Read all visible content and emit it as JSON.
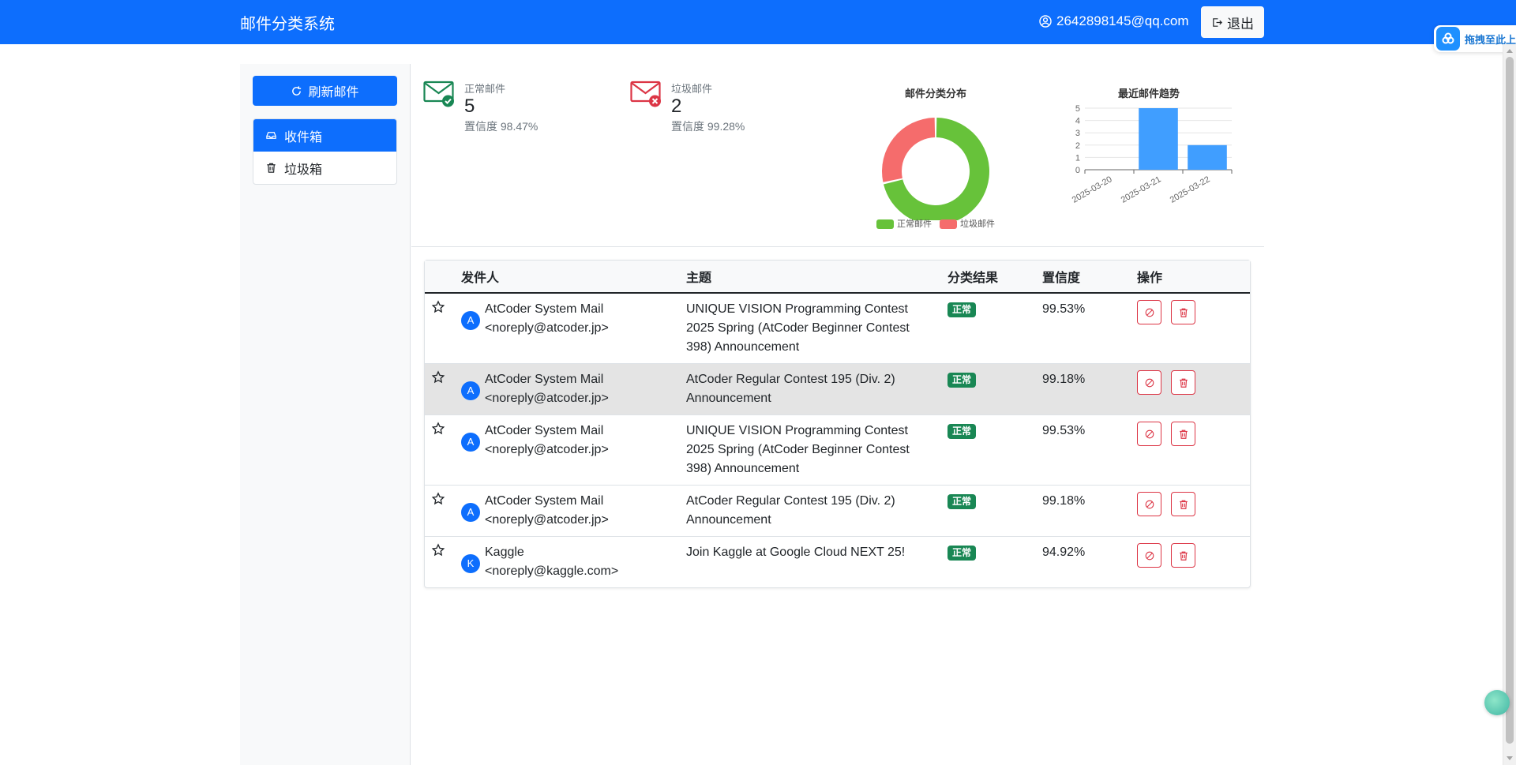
{
  "navbar": {
    "brand": "邮件分类系统",
    "user_email": "2642898145@qq.com",
    "logout_label": "退出"
  },
  "drag_widget": {
    "label": "拖拽至此上"
  },
  "sidebar": {
    "refresh_label": "刷新邮件",
    "items": [
      {
        "label": "收件箱",
        "icon": "inbox-icon",
        "active": true
      },
      {
        "label": "垃圾箱",
        "icon": "trash-icon",
        "active": false
      }
    ]
  },
  "stats": {
    "normal": {
      "label": "正常邮件",
      "count": "5",
      "confidence": "置信度 98.47%",
      "color": "#198754"
    },
    "spam": {
      "label": "垃圾邮件",
      "count": "2",
      "confidence": "置信度 99.28%",
      "color": "#dc3545"
    }
  },
  "charts": {
    "colors": {
      "normal": "#67c23a",
      "spam": "#f56c6c",
      "bar": "#409eff"
    }
  },
  "chart_data": [
    {
      "type": "pie",
      "title": "邮件分类分布",
      "categories": [
        "正常邮件",
        "垃圾邮件"
      ],
      "values": [
        5,
        2
      ],
      "legend": "bottom"
    },
    {
      "type": "bar",
      "title": "最近邮件趋势",
      "categories": [
        "2025-03-20",
        "2025-03-21",
        "2025-03-22"
      ],
      "values": [
        0,
        5,
        2
      ],
      "ylim": [
        0,
        5
      ],
      "yticks": [
        "0",
        "1",
        "2",
        "3",
        "4",
        "5"
      ],
      "grid": true
    }
  ],
  "table": {
    "headers": {
      "sender": "发件人",
      "subject": "主题",
      "result": "分类结果",
      "confidence": "置信度",
      "actions": "操作"
    },
    "rows": [
      {
        "avatar": "A",
        "sender_name": "AtCoder System Mail",
        "sender_email": "<noreply@atcoder.jp>",
        "subject": "UNIQUE VISION Programming Contest 2025 Spring (AtCoder Beginner Contest 398) Announcement",
        "result": "正常",
        "confidence": "99.53%"
      },
      {
        "avatar": "A",
        "sender_name": "AtCoder System Mail",
        "sender_email": "<noreply@atcoder.jp>",
        "subject": "AtCoder Regular Contest 195 (Div. 2) Announcement",
        "result": "正常",
        "confidence": "99.18%"
      },
      {
        "avatar": "A",
        "sender_name": "AtCoder System Mail",
        "sender_email": "<noreply@atcoder.jp>",
        "subject": "UNIQUE VISION Programming Contest 2025 Spring (AtCoder Beginner Contest 398) Announcement",
        "result": "正常",
        "confidence": "99.53%"
      },
      {
        "avatar": "A",
        "sender_name": "AtCoder System Mail",
        "sender_email": "<noreply@atcoder.jp>",
        "subject": "AtCoder Regular Contest 195 (Div. 2) Announcement",
        "result": "正常",
        "confidence": "99.18%"
      },
      {
        "avatar": "K",
        "sender_name": "Kaggle",
        "sender_email": "<noreply@kaggle.com>",
        "subject": "Join Kaggle at Google Cloud NEXT 25!",
        "result": "正常",
        "confidence": "94.92%"
      }
    ]
  }
}
